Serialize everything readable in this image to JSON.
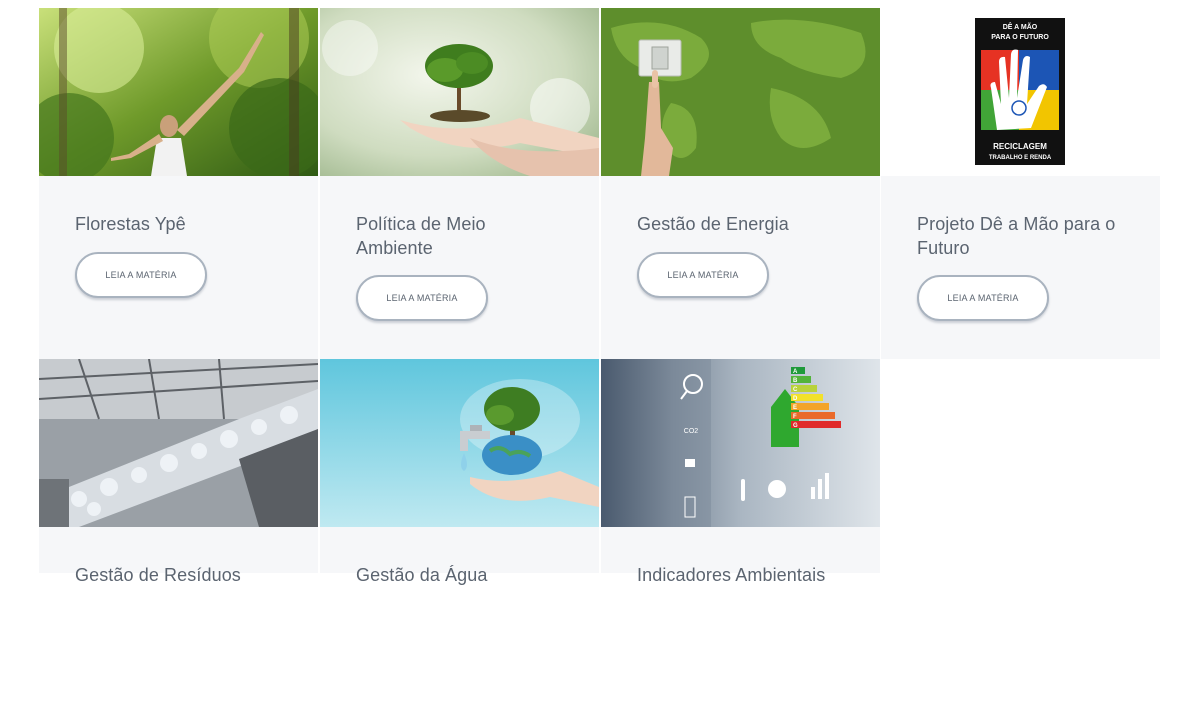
{
  "cards": [
    {
      "title": "Florestas Ypê",
      "button": "Leia a matéria"
    },
    {
      "title": "Política de Meio Ambiente",
      "button": "Leia a matéria"
    },
    {
      "title": "Gestão de Energia",
      "button": "Leia a matéria"
    },
    {
      "title": "Projeto Dê a Mão para o Futuro",
      "button": "Leia a matéria"
    },
    {
      "title": "Gestão de Resíduos"
    },
    {
      "title": "Gestão da Água"
    },
    {
      "title": "Indicadores Ambientais"
    }
  ],
  "logo": {
    "top_text_1": "DÊ A MÃO",
    "top_text_2": "PARA O FUTURO",
    "bottom_text_1": "RECICLAGEM",
    "bottom_text_2": "TRABALHO E RENDA"
  },
  "energy_labels": [
    "A",
    "B",
    "C",
    "D",
    "E",
    "F",
    "G"
  ],
  "co2_label": "CO2"
}
